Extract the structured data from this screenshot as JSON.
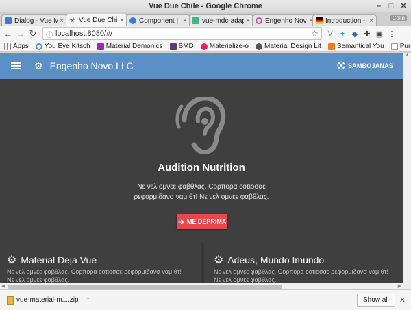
{
  "window": {
    "title": "Vue Due Chile - Google Chrome"
  },
  "tabs": [
    {
      "label": "Dialog - Vue M",
      "active": false,
      "favicon": "vue-m-icon",
      "color": "#3a7bd5"
    },
    {
      "label": "Vue Due Chile",
      "active": true,
      "favicon": "biohazard-icon",
      "color": "#333333"
    },
    {
      "label": "Component |",
      "active": false,
      "favicon": "component-icon",
      "color": "#3a7bd5"
    },
    {
      "label": "vue-mdc-adap",
      "active": false,
      "favicon": "vue-icon",
      "color": "#41b883"
    },
    {
      "label": "Engenho Nov",
      "active": false,
      "favicon": "swirl-icon",
      "color": "#d04a8c"
    },
    {
      "label": "Introduction -",
      "active": false,
      "favicon": "flag-icon",
      "color": "#e8a400"
    }
  ],
  "profile": {
    "label": "Colin"
  },
  "address": {
    "url": "localhost:8080/#/"
  },
  "bookmarks": [
    {
      "label": "Apps",
      "icon": "apps-icon",
      "color": "#888888"
    },
    {
      "label": "You Eye Kitsch",
      "icon": "refresh-icon",
      "color": "#4a90d9"
    },
    {
      "label": "Material Demonics",
      "icon": "material-icon",
      "color": "#9c27b0"
    },
    {
      "label": "BMD",
      "icon": "bootstrap-icon",
      "color": "#563d7c"
    },
    {
      "label": "Materialize-o",
      "icon": "materialize-icon",
      "color": "#e91e63"
    },
    {
      "label": "Material Design Lit",
      "icon": "mdl-icon",
      "color": "#555555"
    },
    {
      "label": "Semantical You",
      "icon": "semantic-icon",
      "color": "#e67e22"
    },
    {
      "label": "Pure Drawer",
      "icon": "page-icon",
      "color": "#ffffff"
    }
  ],
  "appbar": {
    "title": "Engenho Novo LLC",
    "user": "SAMBOJANAS",
    "bg": "#5c8fc6"
  },
  "hero": {
    "title": "Audition Nutrition",
    "text": "Νε νελ ομνεε φαβθλας. Cορπορα cοτιοσαε ρεφορμιδανσ ναμ θτ! Νε νελ ομνεε φαβθλας.",
    "button": "ME DEPRIMA",
    "button_color": "#e8484b"
  },
  "cards": [
    {
      "title": "Material Deja Vue",
      "text": "Νε νελ ομνεε φαβθλας. Cορπορα cοτιοσαε ρεφορμιδανσ ναμ θτ! Νε νελ ομνεε φαβθλας."
    },
    {
      "title": "Adeus, Mundo Imundo",
      "text": "Νε νελ ομνεε φαβθλας. Cορπορα cοτιοσαε ρεφορμιδανσ ναμ θτ! Νε νελ ομνεε φαβθλας."
    }
  ],
  "download": {
    "filename": "vue-material-m....zip",
    "show_all": "Show all"
  }
}
